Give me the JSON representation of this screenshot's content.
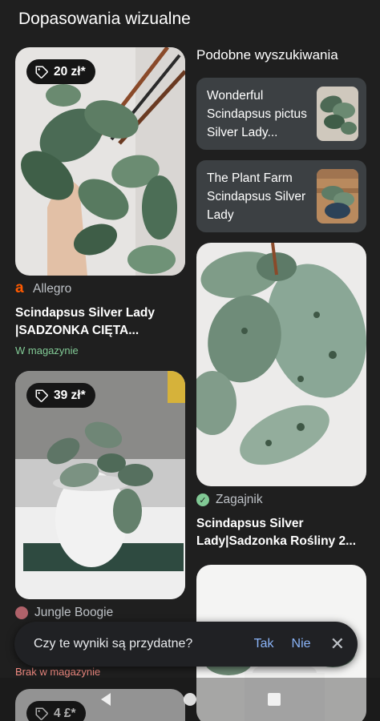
{
  "header": {
    "title": "Dopasowania wizualne"
  },
  "left_column": {
    "cards": [
      {
        "price": "20 zł*",
        "source": "Allegro",
        "title_line1": "Scindapsus Silver Lady",
        "title_line2": "|SADZONKA CIĘTA...",
        "stock": "W magazynie"
      },
      {
        "price": "39 zł*",
        "source": "Jungle Boogie",
        "stock": "Brak w magazynie"
      },
      {
        "price": "4 £*"
      }
    ]
  },
  "right_column": {
    "section_title": "Podobne wyszukiwania",
    "related": [
      {
        "line1": "Wonderful",
        "line2": "Scindapsus pictus",
        "line3": "Silver Lady..."
      },
      {
        "line1": "The Plant Farm",
        "line2": "Scindapsus Silver",
        "line3": "Lady"
      }
    ],
    "card": {
      "source": "Zagajnik",
      "title_line1": "Scindapsus Silver",
      "title_line2": "Lady|Sadzonka Rośliny 2..."
    }
  },
  "feedback": {
    "question": "Czy te wyniki są przydatne?",
    "yes": "Tak",
    "no": "Nie"
  },
  "icons": {
    "price_tag": "tag-icon",
    "close": "close-icon",
    "back": "back-nav-icon",
    "home": "home-nav-icon",
    "recents": "recents-nav-icon"
  },
  "colors": {
    "background": "#1f1f1f",
    "accent_link": "#8ab4f8",
    "in_stock": "#81c995",
    "out_of_stock": "#f28b82",
    "allegro": "#ff5a00"
  }
}
